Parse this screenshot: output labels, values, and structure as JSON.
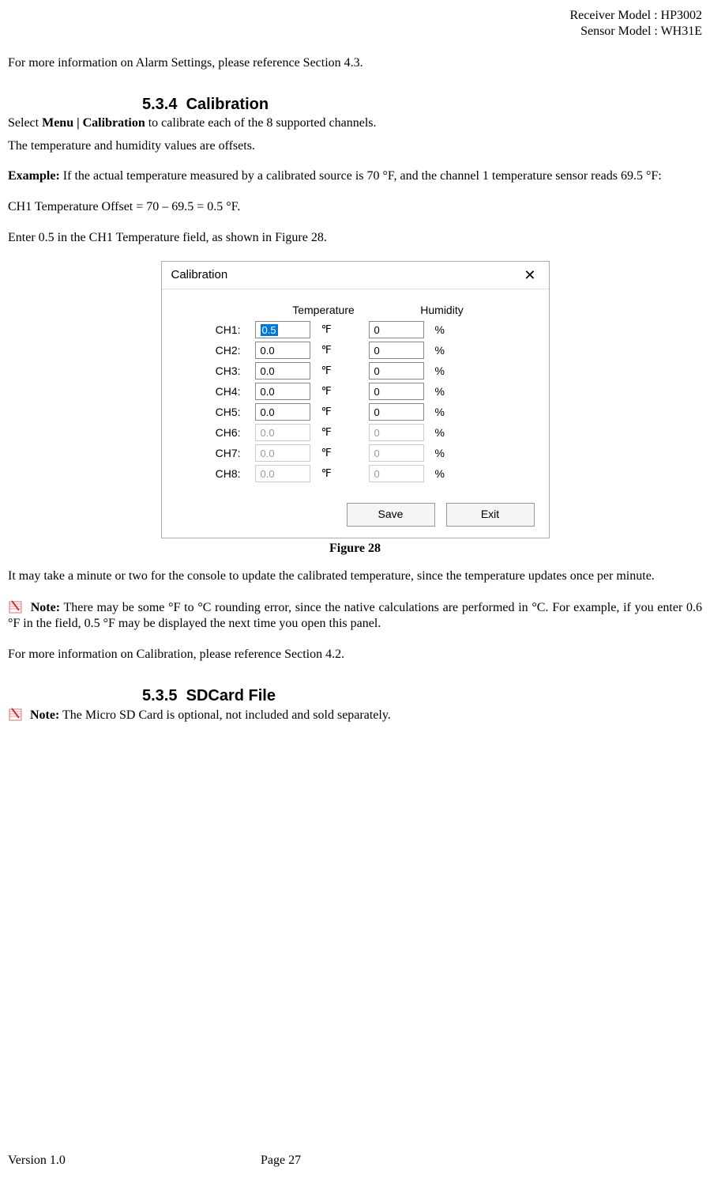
{
  "header": {
    "receiver": "Receiver Model : HP3002",
    "sensor": "Sensor Model : WH31E"
  },
  "intro_ref": "For more information on Alarm Settings, please reference Section 4.3.",
  "section_534": {
    "num": "5.3.4",
    "title": "Calibration",
    "select_line_pre": "Select ",
    "select_line_bold": "Menu | Calibration",
    "select_line_post": " to calibrate each of the 8 supported channels.",
    "offsets_line": "The temperature and humidity values are offsets.",
    "example_label": "Example:",
    "example_body": " If the actual temperature measured by a calibrated source is 70 °F, and the channel 1 temperature sensor reads 69.5 °F:",
    "offset_calc": "CH1 Temperature Offset = 70 – 69.5 = 0.5 °F.",
    "enter_line": "Enter 0.5 in the CH1 Temperature field, as shown in Figure 28."
  },
  "dialog": {
    "title": "Calibration",
    "col_temp": "Temperature",
    "col_hum": "Humidity",
    "rows": [
      {
        "label": "CH1:",
        "temp": "0.5",
        "hum": "0",
        "enabled": true,
        "selected": true
      },
      {
        "label": "CH2:",
        "temp": "0.0",
        "hum": "0",
        "enabled": true,
        "selected": false
      },
      {
        "label": "CH3:",
        "temp": "0.0",
        "hum": "0",
        "enabled": true,
        "selected": false
      },
      {
        "label": "CH4:",
        "temp": "0.0",
        "hum": "0",
        "enabled": true,
        "selected": false
      },
      {
        "label": "CH5:",
        "temp": "0.0",
        "hum": "0",
        "enabled": true,
        "selected": false
      },
      {
        "label": "CH6:",
        "temp": "0.0",
        "hum": "0",
        "enabled": false,
        "selected": false
      },
      {
        "label": "CH7:",
        "temp": "0.0",
        "hum": "0",
        "enabled": false,
        "selected": false
      },
      {
        "label": "CH8:",
        "temp": "0.0",
        "hum": "0",
        "enabled": false,
        "selected": false
      }
    ],
    "unit_temp": "℉",
    "unit_hum": "%",
    "save": "Save",
    "exit": "Exit"
  },
  "figure_caption": "Figure 28",
  "after_fig": "It may take a minute or two for the console to update the calibrated temperature, since the temperature updates once per minute.",
  "note1_label": "Note:",
  "note1_body": " There may be some °F to °C rounding error, since the native calculations are performed in °C. For example, if you enter 0.6 °F in the field, 0.5 °F may be displayed the next time you open this panel.",
  "calib_ref": "For more information on Calibration, please reference Section 4.2.",
  "section_535": {
    "num": "5.3.5",
    "title": "SDCard File"
  },
  "note2_label": "Note:",
  "note2_body": " The Micro SD Card is optional, not included and sold separately.",
  "footer": {
    "version": "Version 1.0",
    "page": "Page 27"
  }
}
